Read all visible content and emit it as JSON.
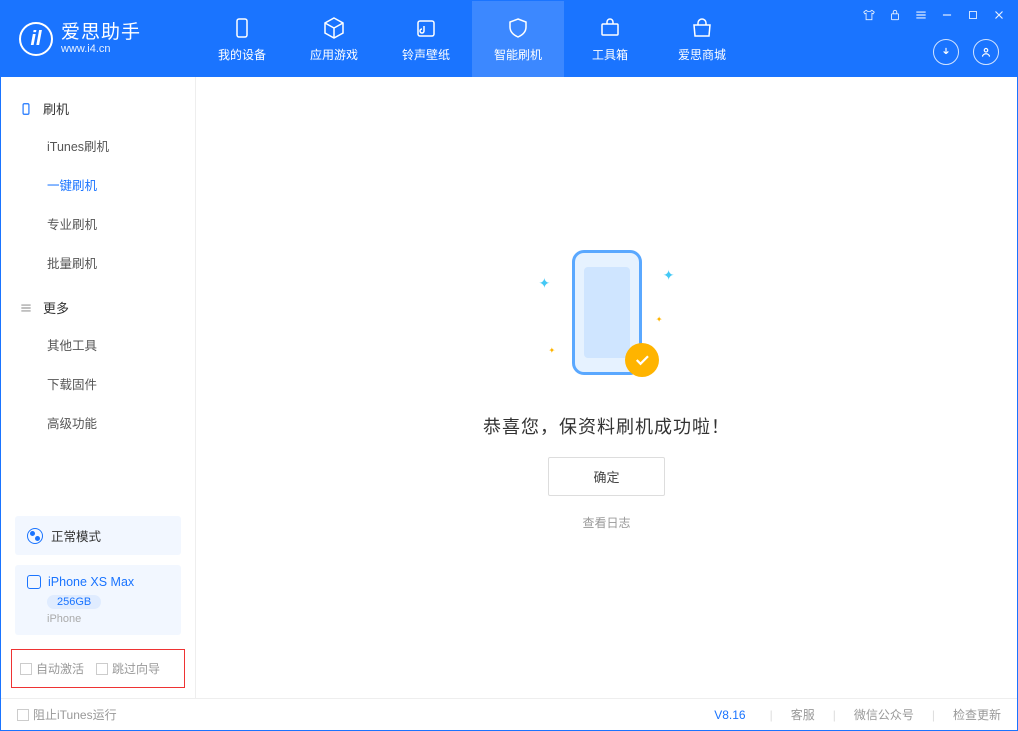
{
  "header": {
    "logo_title": "爱思助手",
    "logo_sub": "www.i4.cn",
    "tabs": [
      {
        "label": "我的设备"
      },
      {
        "label": "应用游戏"
      },
      {
        "label": "铃声壁纸"
      },
      {
        "label": "智能刷机"
      },
      {
        "label": "工具箱"
      },
      {
        "label": "爱思商城"
      }
    ]
  },
  "sidebar": {
    "group1_title": "刷机",
    "group1_items": [
      "iTunes刷机",
      "一键刷机",
      "专业刷机",
      "批量刷机"
    ],
    "group2_title": "更多",
    "group2_items": [
      "其他工具",
      "下载固件",
      "高级功能"
    ],
    "status_label": "正常模式",
    "device_name": "iPhone XS Max",
    "device_capacity": "256GB",
    "device_type": "iPhone",
    "check_auto_activate": "自动激活",
    "check_skip_guide": "跳过向导"
  },
  "main": {
    "success_text": "恭喜您，保资料刷机成功啦！",
    "ok_button": "确定",
    "view_log": "查看日志"
  },
  "footer": {
    "block_itunes": "阻止iTunes运行",
    "version": "V8.16",
    "link_support": "客服",
    "link_wechat": "微信公众号",
    "link_update": "检查更新"
  }
}
